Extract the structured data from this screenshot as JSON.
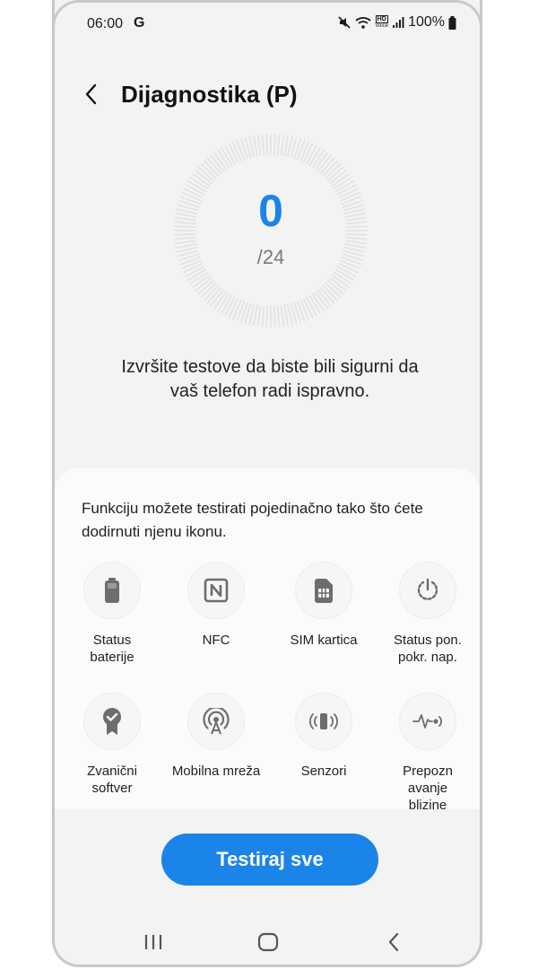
{
  "status_bar": {
    "time": "06:00",
    "g_label": "G",
    "hd_label": "HD",
    "voice_label": "Voice",
    "battery": "100%"
  },
  "header": {
    "title": "Dijagnostika (P)",
    "back_icon": "chevron-left-icon"
  },
  "progress": {
    "score": "0",
    "total": "/24",
    "accent": "#1a84e8"
  },
  "description": "Izvršite testove da biste bili sigurni da vaš telefon radi ispravno.",
  "sheet": {
    "hint": "Funkciju možete testirati pojedinačno tako što ćete dodirnuti njenu ikonu.",
    "tests": [
      {
        "label_line1": "Status",
        "label_line2": "baterije",
        "icon": "battery-icon"
      },
      {
        "label_line1": "NFC",
        "label_line2": "",
        "icon": "nfc-icon"
      },
      {
        "label_line1": "SIM kartica",
        "label_line2": "",
        "icon": "sim-card-icon"
      },
      {
        "label_line1": "Status pon.",
        "label_line2": "pokr. nap.",
        "icon": "power-restart-icon"
      },
      {
        "label_line1": "Zvanični",
        "label_line2": "softver",
        "icon": "certificate-icon"
      },
      {
        "label_line1": "Mobilna mreža",
        "label_line2": "",
        "icon": "antenna-icon"
      },
      {
        "label_line1": "Senzori",
        "label_line2": "",
        "icon": "sensor-icon"
      },
      {
        "label_line1": "Prepozn",
        "label_line2": "avanje",
        "label_line3": "blizine",
        "icon": "proximity-icon"
      }
    ]
  },
  "actions": {
    "test_all": "Testiraj sve"
  },
  "navbar": {
    "recents": "recents-icon",
    "home": "home-icon",
    "back": "back-icon"
  }
}
